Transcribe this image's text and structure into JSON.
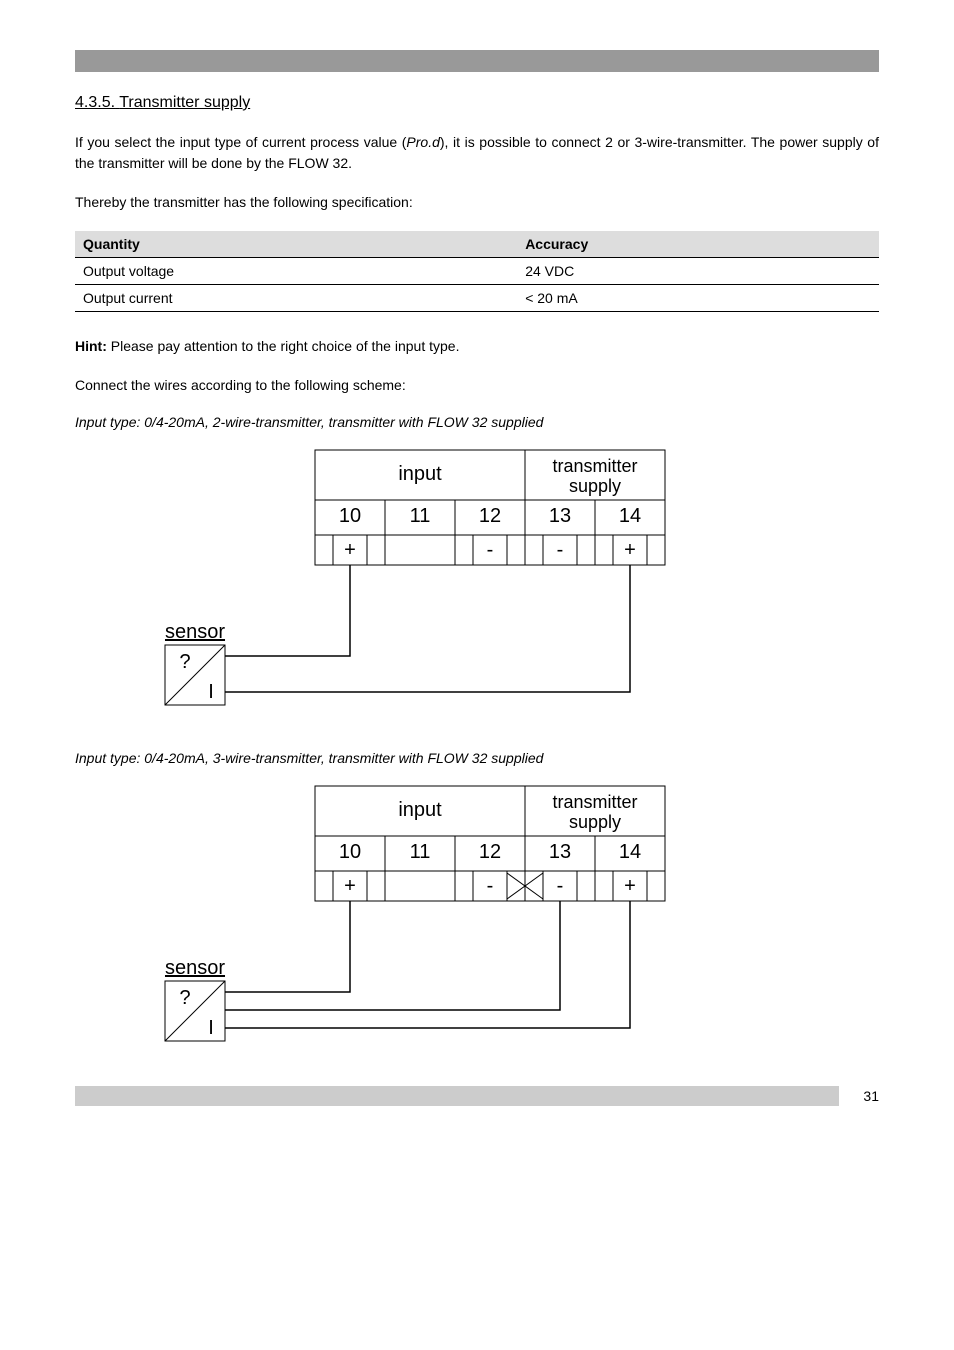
{
  "section": {
    "number": "4.3.5.",
    "title": "Transmitter supply"
  },
  "paragraphs": {
    "intro": "If you select the input type of current process value (",
    "intro_em": "Pro.d",
    "intro_2": "), it is possible to connect 2 or 3-wire-transmitter. The power supply of the transmitter will be done by the FLOW 32.",
    "spec_lead": "Thereby the transmitter has the following specification:"
  },
  "table": {
    "headers": {
      "qty": "Quantity",
      "acc": "Accuracy"
    },
    "rows": [
      {
        "qty": "Output voltage",
        "acc": "24 VDC"
      },
      {
        "qty": "Output current",
        "acc": "< 20 mA"
      }
    ]
  },
  "instructions": {
    "line_lead": "Hint:",
    "line_body": " Please pay attention to the right choice of the input type.",
    "refer": "Connect the wires according to the following scheme:"
  },
  "diagrams": {
    "labels": {
      "input": "input",
      "tx": "transmitter",
      "supply": "supply",
      "sensor": "sensor",
      "symI": "I",
      "symQ": "?",
      "plus": "+",
      "minus": "-"
    },
    "terminals": {
      "t10": "10",
      "t11": "11",
      "t12": "12",
      "t13": "13",
      "t14": "14"
    },
    "caption1": "Input type: 0/4-20mA, 2-wire-transmitter, transmitter with FLOW 32 supplied",
    "caption2": "Input type: 0/4-20mA, 3-wire-transmitter, transmitter with FLOW 32 supplied"
  },
  "footer": {
    "page": "31"
  }
}
